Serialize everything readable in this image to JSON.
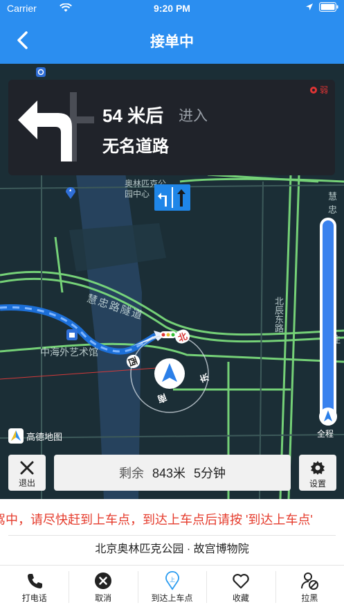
{
  "status": {
    "carrier": "Carrier",
    "time": "9:20 PM"
  },
  "nav": {
    "title": "接单中"
  },
  "guide": {
    "distance": "54 米后",
    "enter": "进入",
    "road": "无名道路",
    "signal": "弱"
  },
  "map_labels": {
    "park": "奥林匹克公\n园中心",
    "huizhong_tunnel": "慧忠路隧道",
    "zhonghai": "中海外艺术馆",
    "beichen": "北辰东路",
    "huizhong_right": "慧忠",
    "zhu": "住"
  },
  "compass": {
    "north": "北",
    "east": "东",
    "south": "南",
    "west": "西"
  },
  "overview_label": "全程",
  "gaode_logo": "高德地图",
  "exit_label": "退出",
  "remain": {
    "label": "剩余",
    "distance": "843米",
    "time": "5分钟"
  },
  "settings_label": "设置",
  "notice": "接驾中，请尽快赶到上车点，到达上车点后请按 '到达上车点'",
  "route": "北京奥林匹克公园 · 故宫博物院",
  "actions": [
    {
      "label": "打电话",
      "icon": "phone-icon"
    },
    {
      "label": "取消",
      "icon": "cancel-icon"
    },
    {
      "label": "到达上车点",
      "icon": "pickup-pin-icon"
    },
    {
      "label": "收藏",
      "icon": "heart-icon"
    },
    {
      "label": "拉黑",
      "icon": "block-user-icon"
    }
  ],
  "colors": {
    "brand": "#2b8ef0",
    "notice": "#e53b2c",
    "route_line": "#3a82ee",
    "road_green": "#7fe37f"
  }
}
